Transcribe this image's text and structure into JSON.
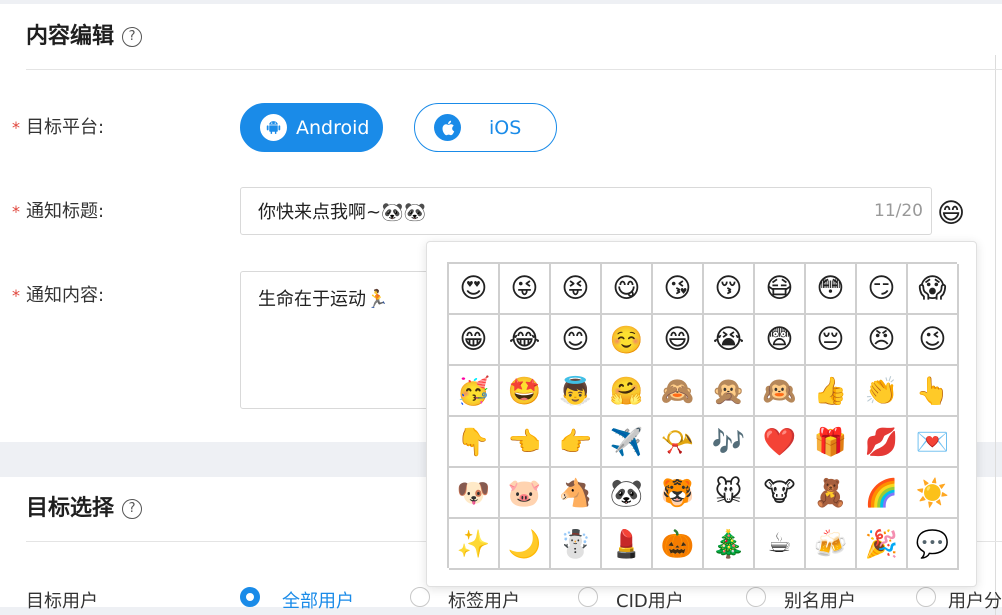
{
  "content_section": {
    "title": "内容编辑",
    "help": "?"
  },
  "platform": {
    "label": "目标平台:",
    "required_mark": "*",
    "android_label": "Android",
    "ios_label": "iOS",
    "selected": "Android"
  },
  "notify_title": {
    "label": "通知标题:",
    "required_mark": "*",
    "value": "你快来点我啊~🐼🐼",
    "counter": "11/20",
    "emoji_button": "😄"
  },
  "notify_content": {
    "label": "通知内容:",
    "required_mark": "*",
    "value": "生命在于运动🏃"
  },
  "target_section": {
    "title": "目标选择",
    "help": "?"
  },
  "target_user": {
    "label": "目标用户",
    "options": [
      "全部用户",
      "标签用户",
      "CID用户",
      "别名用户",
      "用户分"
    ],
    "selected": "全部用户"
  },
  "emoji_panel": {
    "rows": [
      [
        "😍",
        "😜",
        "😝",
        "😋",
        "😘",
        "😚",
        "😷",
        "😳",
        "😏",
        "😱"
      ],
      [
        "😁",
        "😂",
        "😊",
        "☺️",
        "😄",
        "😭",
        "😨",
        "😔",
        "😠",
        "😉"
      ],
      [
        "🥳",
        "🤩",
        "👼",
        "🤗",
        "🙈",
        "🙊",
        "🙉",
        "👍",
        "👏",
        "👆"
      ],
      [
        "👇",
        "👈",
        "👉",
        "✈️",
        "📯",
        "🎶",
        "❤️",
        "🎁",
        "💋",
        "💌"
      ],
      [
        "🐶",
        "🐷",
        "🐴",
        "🐼",
        "🐯",
        "🐭",
        "🐮",
        "🧸",
        "🌈",
        "☀️"
      ],
      [
        "✨",
        "🌙",
        "☃️",
        "💄",
        "🎃",
        "🎄",
        "☕",
        "🍻",
        "🎉",
        "💬"
      ]
    ]
  },
  "colors": {
    "accent": "#1a8be8",
    "required": "#e0443a"
  }
}
